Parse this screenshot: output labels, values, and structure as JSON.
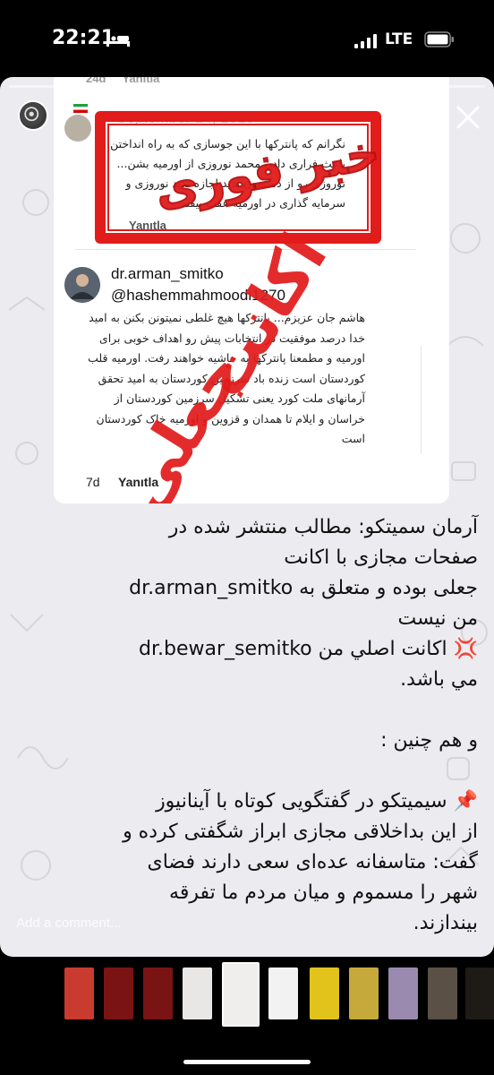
{
  "status_bar": {
    "time": "22:21",
    "network": "LTE",
    "icons": [
      "bed-icon",
      "signal-icon",
      "battery-icon"
    ]
  },
  "story": {
    "close_icon": "close-icon",
    "comment_placeholder": "Add a comment..."
  },
  "screenshot": {
    "old_reply_time": "24d",
    "old_reply_label": "Yanıtla",
    "date": "September 14, 2019",
    "comment1": "نگرانم که پانترکها با این جوسازی که به راه انداختن باعث فراری دادن محمد نوروزی از اورمیه بشن... نوروزی رو از دستمون ندید اجازه ندید نوروزی و سرمایه گذاری در اورمیه عقب بیفته",
    "comment1_reply": "Yanıtla",
    "username": "dr.arman_smitko",
    "mention": "@hashemmahmoodi1270",
    "comment2": "هاشم جان عزیزم... پانترکها هیچ غلطی نمیتونن بکنن به امید خدا درصد موفقیت در انتخابات پیش رو اهداف خوبی برای اورمیه و مطمعنا پانترکها به حاشیه خواهند رفت. اورمیه قلب کوردستان است زنده باد سرزمین کوردستان به امید تحقق آرمانهای ملت کورد یعنی تشکیل سرزمین کوردستان از خراسان و ایلام تا همدان و قزوین و اورمیه خاک کوردستان است",
    "comment2_age": "7d",
    "comment2_reply": "Yanıtla"
  },
  "stamps": {
    "breaking_news": "خبر فوری",
    "fake_line1": "اکانت",
    "fake_line2": "جعلی"
  },
  "caption": {
    "line1": "آرمان سمیتکو: مطالب منتشر شده در",
    "line2": "صفحات مجازی با اکانت",
    "line3_handle": "dr.arman_smitko",
    "line3_text": "جعلی بوده و متعلق به",
    "line4": "من نیست",
    "line5_emoji": "💢",
    "line5_text": "اکانت اصلي من",
    "line5_handle": "dr.bewar_semitko",
    "line6": "مي باشد.",
    "line7": "و هم چنین :",
    "line8_emoji": "📌",
    "line8_text": "سیمیتکو در گفتگویی کوتاه با آینانیوز",
    "line9": "از این بداخلاقی مجازی ابراز شگفتی کرده و",
    "line10": "گفت: متاسفانه عده‌ای سعی دارند فضای",
    "line11": "شهر را مسموم و میان مردم ما تفرقه",
    "line12": "بیندازند."
  },
  "thumbnails": [
    {
      "color": "#c93a2f"
    },
    {
      "color": "#7a1414"
    },
    {
      "color": "#7a1414"
    },
    {
      "color": "#e9e6e6"
    },
    {
      "color": "#f0eded",
      "active": true
    },
    {
      "color": "#f2f2f2"
    },
    {
      "color": "#e2c31c"
    },
    {
      "color": "#c6a93b"
    },
    {
      "color": "#9b8ab0"
    },
    {
      "color": "#5a5045"
    },
    {
      "color": "#1e1a16"
    }
  ]
}
